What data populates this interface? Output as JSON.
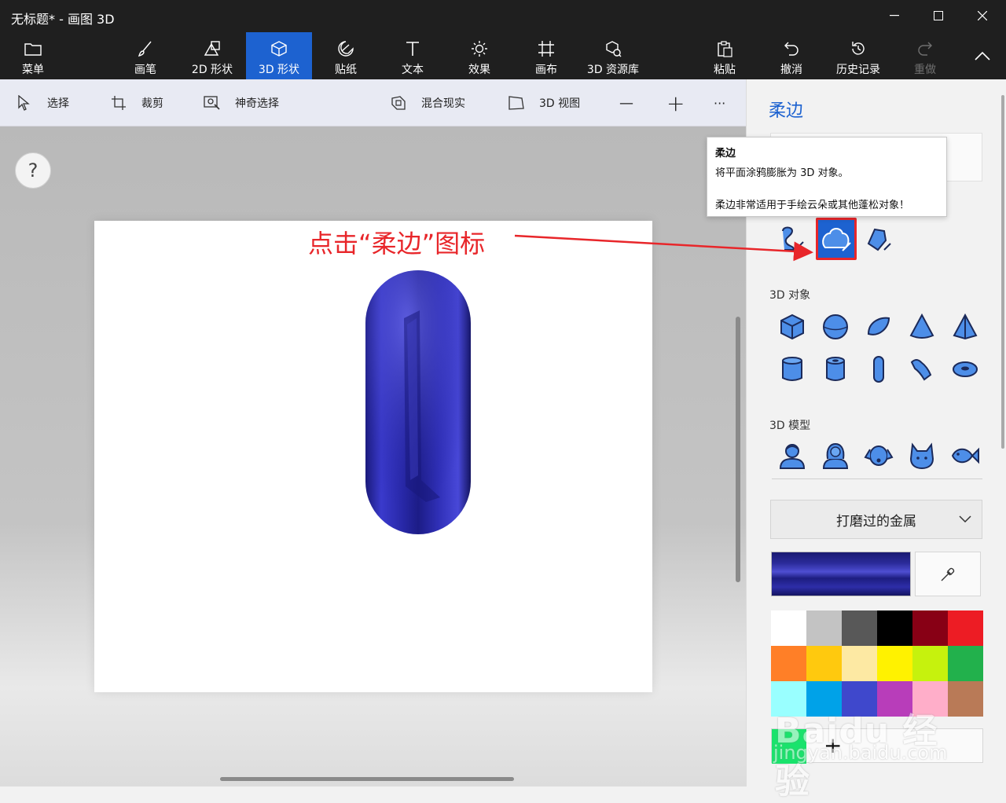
{
  "window": {
    "title": "无标题* - 画图 3D",
    "minimize": "—",
    "maximize": "☐",
    "close": "✕"
  },
  "ribbon": {
    "tabs": [
      {
        "label": "菜单",
        "icon": "folder-icon"
      },
      {
        "label": "画笔",
        "icon": "brush-icon"
      },
      {
        "label": "2D 形状",
        "icon": "shapes-2d-icon"
      },
      {
        "label": "3D 形状",
        "icon": "cube-icon",
        "active": true
      },
      {
        "label": "贴纸",
        "icon": "sticker-icon"
      },
      {
        "label": "文本",
        "icon": "text-icon"
      },
      {
        "label": "效果",
        "icon": "sun-icon"
      },
      {
        "label": "画布",
        "icon": "canvas-icon"
      },
      {
        "label": "3D 资源库",
        "icon": "library-icon"
      },
      {
        "label": "粘贴",
        "icon": "paste-icon"
      },
      {
        "label": "撤消",
        "icon": "undo-icon"
      },
      {
        "label": "历史记录",
        "icon": "history-icon"
      },
      {
        "label": "重做",
        "icon": "redo-icon",
        "disabled": true
      }
    ]
  },
  "toolbar": {
    "select": "选择",
    "crop": "裁剪",
    "magic_select": "神奇选择",
    "mixed_reality": "混合现实",
    "view_3d": "3D 视图",
    "zoom_out": "—",
    "zoom_in": "+",
    "more": "···"
  },
  "help": "?",
  "annotation": "点击“柔边”图标",
  "panel": {
    "title": "柔边",
    "doodle_tools": [
      "sharp-edge-icon",
      "soft-edge-icon",
      "tube-icon"
    ],
    "objects_label": "3D 对象",
    "objects": [
      "cube-icon",
      "sphere-icon",
      "hemisphere-icon",
      "cone-icon",
      "pyramid-icon",
      "cylinder-icon",
      "tube-icon",
      "capsule-icon",
      "curved-tube-icon",
      "donut-icon"
    ],
    "models_label": "3D 模型",
    "models": [
      "man-icon",
      "woman-icon",
      "dog-icon",
      "cat-icon",
      "fish-icon"
    ],
    "material": "打磨过的金属",
    "palette": [
      "#ffffff",
      "#c3c3c3",
      "#585858",
      "#000000",
      "#880015",
      "#ed1c24",
      "#ff7f27",
      "#ffc90e",
      "#fde9a3",
      "#fff200",
      "#c6f20d",
      "#22b14c",
      "#99ffff",
      "#00a2e8",
      "#3f48cc",
      "#b83dba",
      "#ffaec9",
      "#b97a57"
    ],
    "custom_color": "#19e36c"
  },
  "tooltip": {
    "title": "柔边",
    "line1": "将平面涂鸦膨胀为 3D 对象。",
    "line2": "柔边非常适用于手绘云朵或其他蓬松对象！"
  },
  "watermark": {
    "brand": "Baidu 经验",
    "url": "jingyan.baidu.com"
  },
  "colors": {
    "accent": "#1d62d0",
    "annotation_red": "#e8262a",
    "object_blue": "#2d2db4"
  }
}
